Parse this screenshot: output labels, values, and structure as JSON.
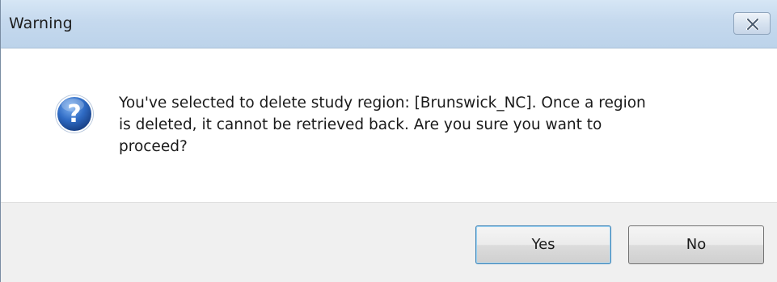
{
  "window": {
    "title": "Warning"
  },
  "titlebar": {
    "close_icon": "close-icon"
  },
  "content": {
    "icon": "question-icon",
    "message_line1": "You've selected to delete study region: [Brunswick_NC]. Once a region",
    "message_line2": "is deleted, it cannot be retrieved back. Are you sure you want to",
    "message_line3": "proceed?"
  },
  "buttons": {
    "yes_label": "Yes",
    "no_label": "No"
  },
  "colors": {
    "titlebar": "#c5d9ee",
    "footer": "#f0f0f0",
    "icon_blue": "#2a5fb0"
  }
}
